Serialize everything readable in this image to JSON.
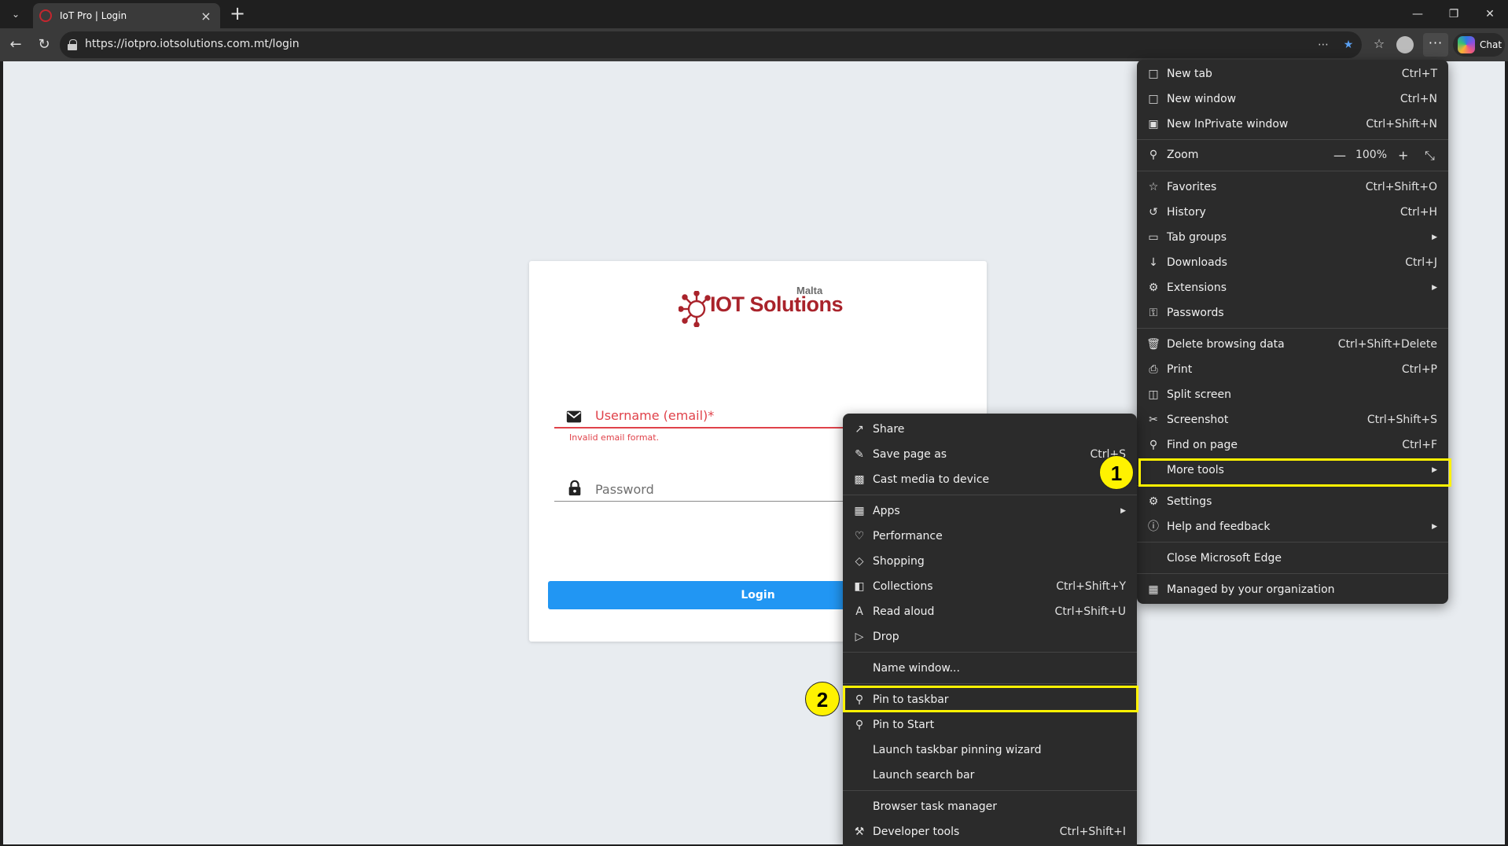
{
  "browser": {
    "tab": {
      "title": "IoT Pro | Login"
    },
    "address_bar": {
      "url": "https://iotpro.iotsolutions.com.mt/login"
    },
    "chat_label": "Chat"
  },
  "page": {
    "logo": {
      "brand": "IOT Solutions",
      "sub_brand": "Malta"
    },
    "username_label": "Username (email)*",
    "username_error": "Invalid email format.",
    "password_label": "Password",
    "login_button": "Login"
  },
  "main_menu": {
    "items": [
      {
        "icon": "new-tab-icon",
        "label": "New tab",
        "shortcut": "Ctrl+T"
      },
      {
        "icon": "new-window-icon",
        "label": "New window",
        "shortcut": "Ctrl+N"
      },
      {
        "icon": "inprivate-icon",
        "label": "New InPrivate window",
        "shortcut": "Ctrl+Shift+N"
      },
      {
        "icon": "zoom-icon",
        "label": "Zoom",
        "zoom_value": "100%"
      },
      {
        "icon": "favorites-icon",
        "label": "Favorites",
        "shortcut": "Ctrl+Shift+O"
      },
      {
        "icon": "history-icon",
        "label": "History",
        "shortcut": "Ctrl+H"
      },
      {
        "icon": "tab-groups-icon",
        "label": "Tab groups"
      },
      {
        "icon": "downloads-icon",
        "label": "Downloads",
        "shortcut": "Ctrl+J"
      },
      {
        "icon": "extensions-icon",
        "label": "Extensions"
      },
      {
        "icon": "passwords-icon",
        "label": "Passwords"
      },
      {
        "icon": "delete-icon",
        "label": "Delete browsing data",
        "shortcut": "Ctrl+Shift+Delete"
      },
      {
        "icon": "print-icon",
        "label": "Print",
        "shortcut": "Ctrl+P"
      },
      {
        "icon": "split-screen-icon",
        "label": "Split screen"
      },
      {
        "icon": "screenshot-icon",
        "label": "Screenshot",
        "shortcut": "Ctrl+Shift+S"
      },
      {
        "icon": "find-icon",
        "label": "Find on page",
        "shortcut": "Ctrl+F"
      },
      {
        "icon": "more-tools-icon",
        "label": "More tools"
      },
      {
        "icon": "settings-icon",
        "label": "Settings"
      },
      {
        "icon": "help-icon",
        "label": "Help and feedback"
      },
      {
        "icon": "",
        "label": "Close Microsoft Edge"
      },
      {
        "icon": "managed-icon",
        "label": "Managed by your organization"
      }
    ]
  },
  "sub_menu": {
    "items": [
      {
        "icon": "share-icon",
        "label": "Share"
      },
      {
        "icon": "save-page-icon",
        "label": "Save page as",
        "shortcut": "Ctrl+S"
      },
      {
        "icon": "cast-icon",
        "label": "Cast media to device"
      },
      {
        "icon": "apps-icon",
        "label": "Apps"
      },
      {
        "icon": "performance-icon",
        "label": "Performance"
      },
      {
        "icon": "shopping-icon",
        "label": "Shopping"
      },
      {
        "icon": "collections-icon",
        "label": "Collections",
        "shortcut": "Ctrl+Shift+Y"
      },
      {
        "icon": "read-aloud-icon",
        "label": "Read aloud",
        "shortcut": "Ctrl+Shift+U"
      },
      {
        "icon": "drop-icon",
        "label": "Drop"
      },
      {
        "icon": "",
        "label": "Name window..."
      },
      {
        "icon": "pin-icon",
        "label": "Pin to taskbar"
      },
      {
        "icon": "pin-icon",
        "label": "Pin to Start"
      },
      {
        "icon": "",
        "label": "Launch taskbar pinning wizard"
      },
      {
        "icon": "",
        "label": "Launch search bar"
      },
      {
        "icon": "",
        "label": "Browser task manager"
      },
      {
        "icon": "developer-tools-icon",
        "label": "Developer tools",
        "shortcut": "Ctrl+Shift+I"
      }
    ]
  },
  "annotations": {
    "step1": "1",
    "step2": "2"
  },
  "colors": {
    "highlight": "#fff200",
    "login_button": "#2196f3",
    "error": "#e0424a",
    "brand": "#a9232b"
  }
}
